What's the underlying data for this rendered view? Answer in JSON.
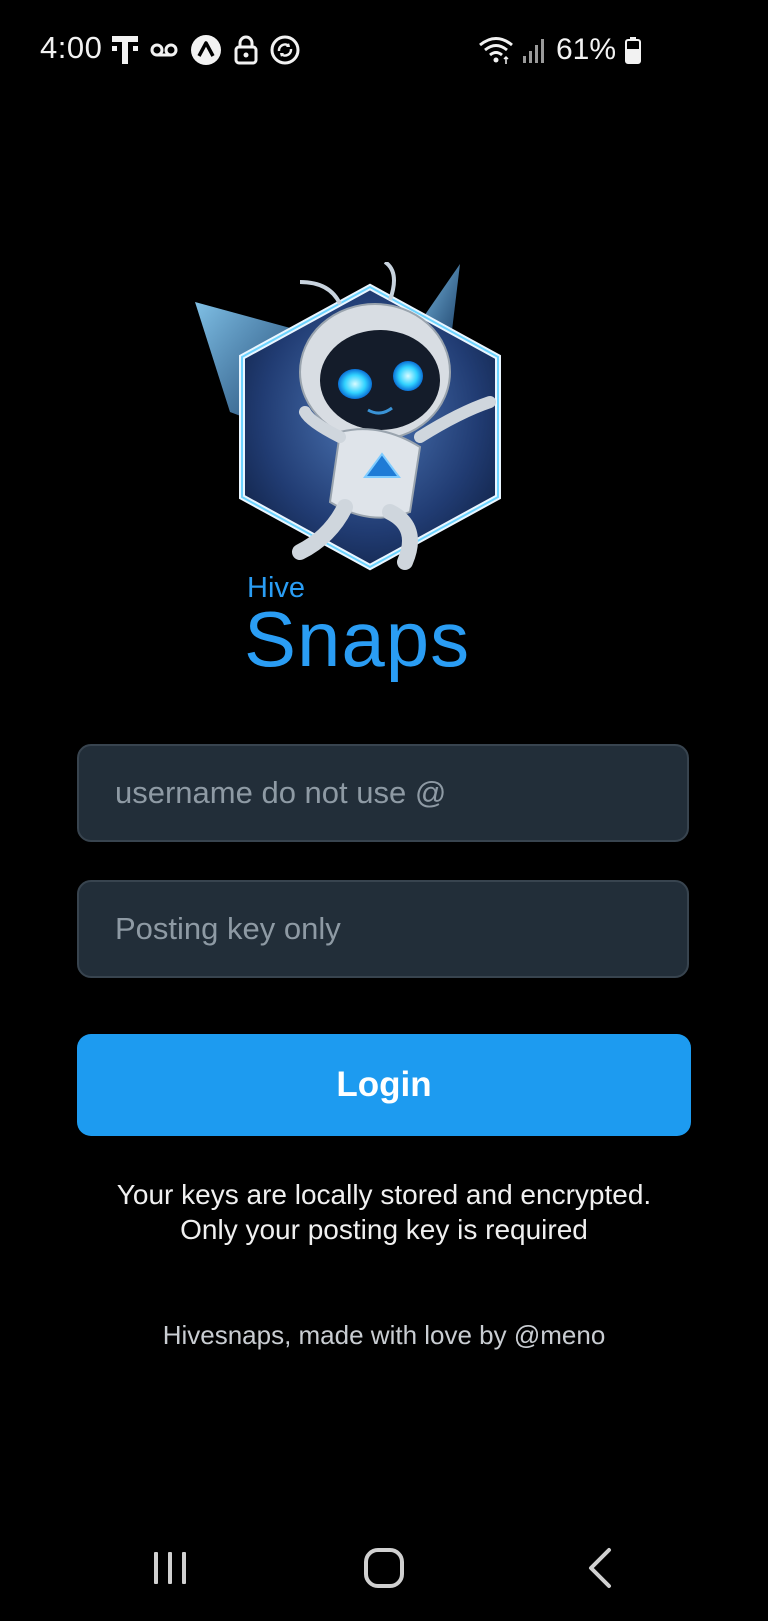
{
  "status_bar": {
    "time": "4:00",
    "battery_percent": "61%",
    "battery_level": 0.61,
    "icons_left": [
      "t-mobile-icon",
      "voicemail-icon",
      "app-notification-icon",
      "lock-icon",
      "sync-icon"
    ],
    "icons_right": [
      "wifi-icon",
      "signal-icon",
      "battery-icon"
    ]
  },
  "brand": {
    "hive": "Hive",
    "snaps": "Snaps",
    "accent_color": "#2a9df4"
  },
  "form": {
    "username_placeholder": "username do not use @",
    "username_value": "",
    "posting_key_placeholder": "Posting key only",
    "posting_key_value": "",
    "login_label": "Login",
    "login_color": "#1d9bf0"
  },
  "info": {
    "line1": "Your keys are locally stored and encrypted.",
    "line2": "Only your posting key is required"
  },
  "footer": {
    "text": "Hivesnaps, made with love by @meno"
  },
  "nav_bar": {
    "icons": [
      "recent-apps-icon",
      "home-icon",
      "back-icon"
    ]
  }
}
